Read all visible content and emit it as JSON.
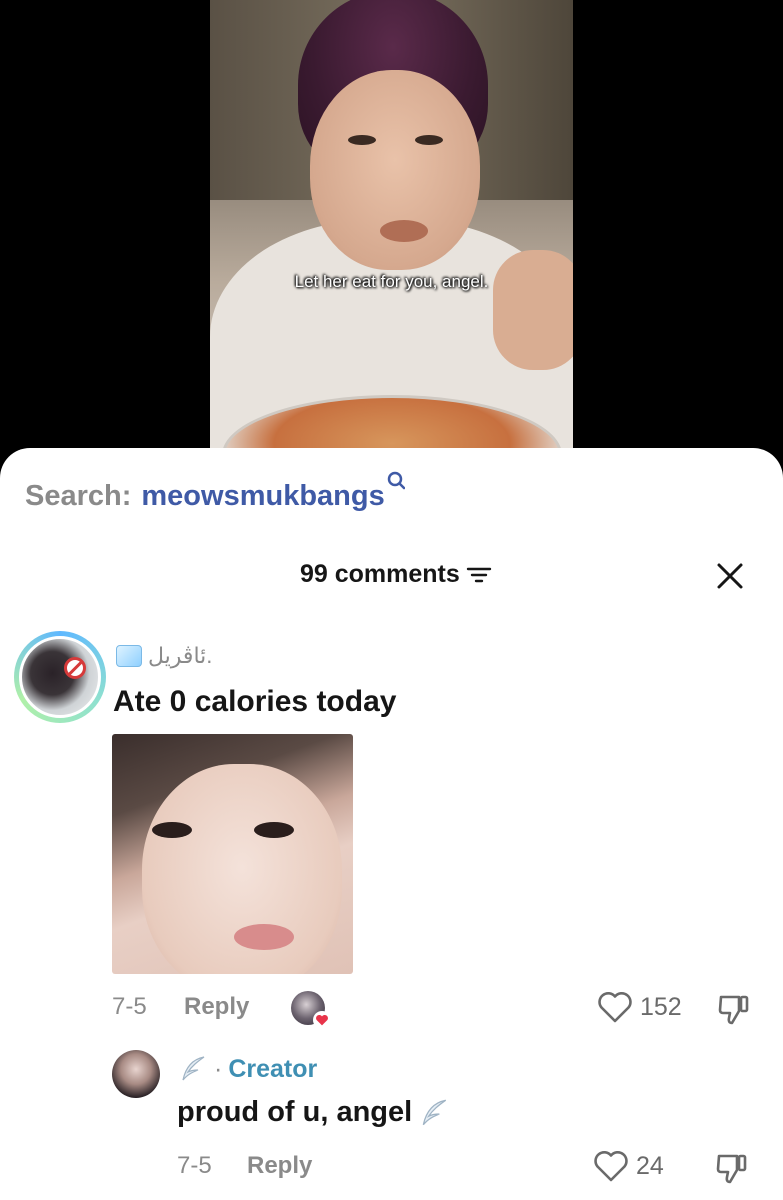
{
  "video": {
    "caption": "Let her eat for you, angel."
  },
  "search": {
    "prefix": "Search:",
    "term": "meowsmukbangs"
  },
  "comments_header": {
    "count_label": "99 comments"
  },
  "comment": {
    "username": "ئاڤريل.",
    "text": "Ate 0 calories today",
    "date": "7-5",
    "reply_label": "Reply",
    "likes": "152"
  },
  "reply": {
    "separator": "·",
    "badge": "Creator",
    "text": "proud of u, angel",
    "date": "7-5",
    "reply_label": "Reply",
    "likes": "24"
  },
  "colors": {
    "search_term": "#3f5aa6",
    "creator_badge": "#3f8fb3",
    "heart_badge": "#e8344a"
  }
}
